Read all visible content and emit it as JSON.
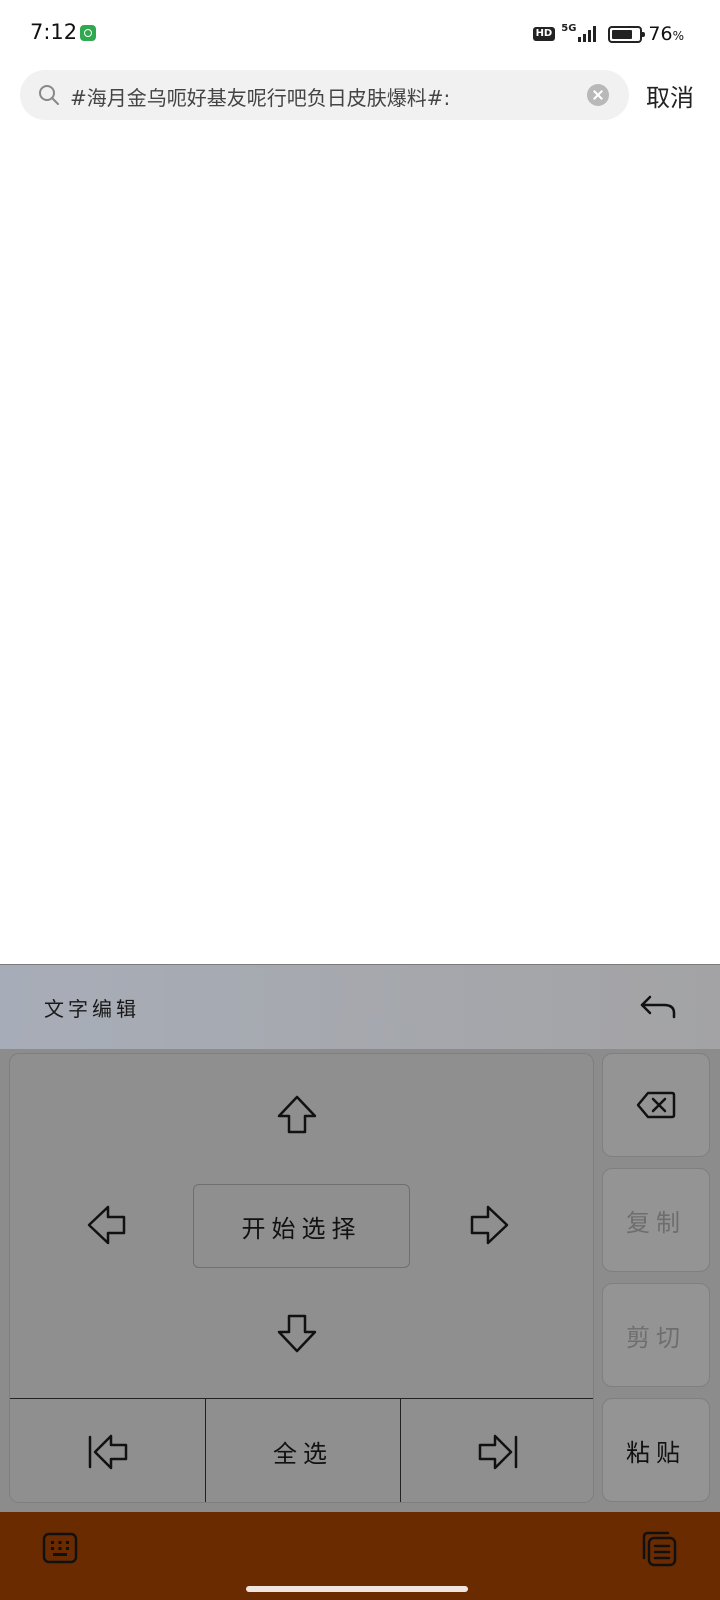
{
  "status_bar": {
    "time": "7:12",
    "network_badge": "HD",
    "network_type": "5G",
    "battery_level": 0.76,
    "battery_percent": "76",
    "battery_unit": "%"
  },
  "search": {
    "query": "#海月金乌呃好基友呢行吧负日皮肤爆料#:",
    "cancel_label": "取消"
  },
  "keyboard": {
    "title": "文字编辑",
    "start_select_label": "开始选择",
    "select_all_label": "全选",
    "side_keys": {
      "copy_label": "复制",
      "cut_label": "剪切",
      "paste_label": "粘贴"
    },
    "icons": {
      "undo": "undo-icon",
      "up": "arrow-up-icon",
      "down": "arrow-down-icon",
      "left": "arrow-left-icon",
      "right": "arrow-right-icon",
      "line_start": "line-start-icon",
      "line_end": "line-end-icon",
      "backspace": "backspace-icon"
    }
  },
  "bottom_bar": {
    "icons": [
      "keyboard-icon",
      "clipboard-icon"
    ],
    "color": "#6a2b00"
  }
}
